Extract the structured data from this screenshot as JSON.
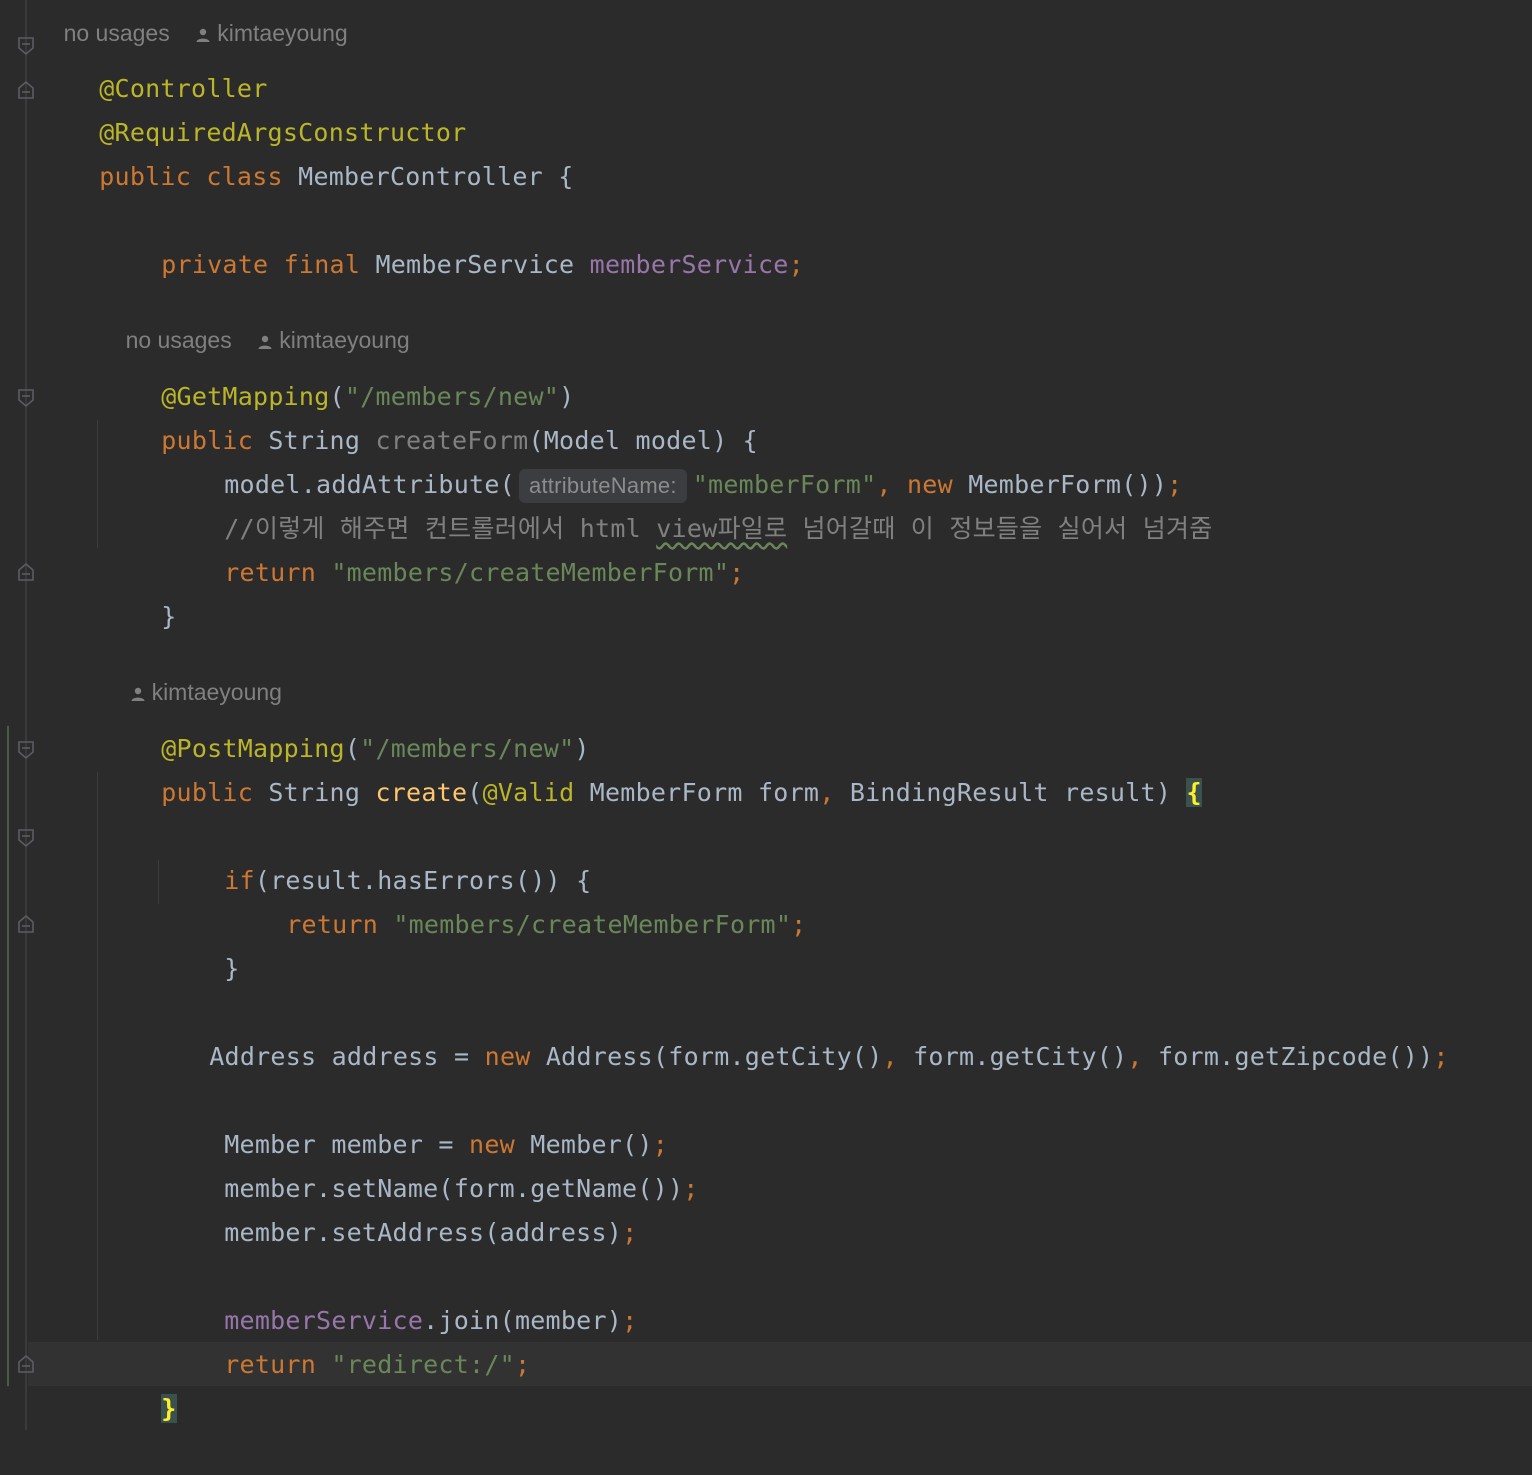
{
  "meta": {
    "top_usages": "no usages",
    "top_author": "kimtaeyoung",
    "createForm_usages": "no usages",
    "createForm_author": "kimtaeyoung",
    "create_author": "kimtaeyoung"
  },
  "code": {
    "l1": "@Controller",
    "l2": "@RequiredArgsConstructor",
    "l3_kw": "public class ",
    "l3_rest": "MemberController {",
    "l4_kw": "private final ",
    "l4_type": "MemberService ",
    "l4_field": "memberService",
    "semi": ";",
    "l5_ann": "@GetMapping",
    "l5_p1": "(",
    "l5_str": "\"/members/new\"",
    "l5_p2": ")",
    "l6_kw": "public ",
    "l6_type": "String ",
    "l6_name": "createForm",
    "l6_rest": "(Model model) {",
    "l7_a": "model.addAttribute(",
    "l7_hint": "attributeName:",
    "l7_str": "\"memberForm\"",
    "l7_comma": ", ",
    "l7_kw": "new ",
    "l7_b": "MemberForm())",
    "l8_a": "//이렇게 해주면 컨트롤러에서 html ",
    "l8_typo": "view파일로",
    "l8_b": " 넘어갈때 이 정보들을 실어서 넘겨줌",
    "l9_kw": "return ",
    "l9_str": "\"members/createMemberForm\"",
    "l10": "}",
    "l11_ann": "@PostMapping",
    "l11_p1": "(",
    "l11_str": "\"/members/new\"",
    "l11_p2": ")",
    "l12_kw": "public ",
    "l12_type": "String ",
    "l12_name": "create",
    "l12_p": "(",
    "l12_ann": "@Valid ",
    "l12_a": "MemberForm form",
    "l12_comma": ", ",
    "l12_b": "BindingResult result) ",
    "l12_brace": "{",
    "l13_kw": "if",
    "l13_rest": "(result.hasErrors()) {",
    "l14_kw": "return ",
    "l14_str": "\"members/createMemberForm\"",
    "l15": "}",
    "l16_a": "Address address = ",
    "l16_kw": "new ",
    "l16_b": "Address(form.getCity()",
    "l16_c1": ", ",
    "l16_c": "form.getCity()",
    "l16_c2": ", ",
    "l16_d": "form.getZipcode())",
    "l17_a": "Member member = ",
    "l17_kw": "new ",
    "l17_b": "Member()",
    "l18": "member.setName(form.getName())",
    "l19": "member.setAddress(address)",
    "l20_field": "memberService",
    "l20_rest": ".join(member)",
    "l21_kw": "return ",
    "l21_str": "\"redirect:/\"",
    "l22_brace": "}"
  },
  "colors": {
    "background": "#2b2b2b",
    "keyword": "#cc7832",
    "annotation": "#bbb529",
    "string": "#6a8759",
    "field": "#9876aa",
    "method_decl": "#ffc66d",
    "comment": "#808080",
    "plain": "#a9b7c6"
  }
}
